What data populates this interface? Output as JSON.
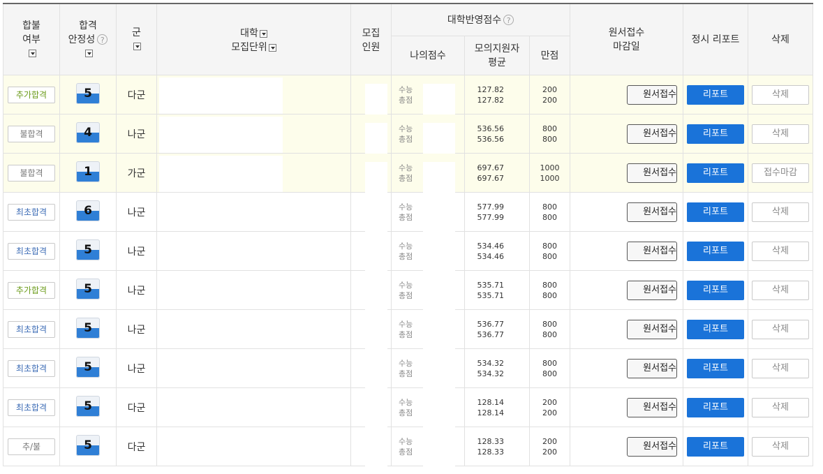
{
  "header": {
    "result": [
      "합불",
      "여부"
    ],
    "stability": [
      "합격",
      "안정성"
    ],
    "group": "군",
    "univ": "대학",
    "unit": "모집단위",
    "recruit": [
      "모집",
      "인원"
    ],
    "score_group": "대학반영점수",
    "my_score": "나의점수",
    "mock_avg": [
      "모의지원자",
      "평균"
    ],
    "full_score": "만점",
    "deadline": [
      "원서접수",
      "마감일"
    ],
    "report": "정시 리포트",
    "delete": "삭제",
    "help_glyph": "?"
  },
  "rows": [
    {
      "status": "추가합격",
      "status_type": "add",
      "stability": "5",
      "group": "다군",
      "score_label1": "수능",
      "score_label2": "총점",
      "avg1": "127.82",
      "avg2": "127.82",
      "full1": "200",
      "full2": "200",
      "apply": "원서접수",
      "report": "리포트",
      "action": "삭제",
      "highlight": true
    },
    {
      "status": "불합격",
      "status_type": "fail",
      "stability": "4",
      "group": "나군",
      "score_label1": "수능",
      "score_label2": "총점",
      "avg1": "536.56",
      "avg2": "536.56",
      "full1": "800",
      "full2": "800",
      "apply": "원서접수",
      "report": "리포트",
      "action": "삭제",
      "highlight": true
    },
    {
      "status": "불합격",
      "status_type": "fail",
      "stability": "1",
      "group": "가군",
      "score_label1": "수능",
      "score_label2": "총점",
      "avg1": "697.67",
      "avg2": "697.67",
      "full1": "1000",
      "full2": "1000",
      "apply": "원서접수",
      "report": "리포트",
      "action": "접수마감",
      "highlight": true
    },
    {
      "status": "최초합격",
      "status_type": "pass",
      "stability": "6",
      "group": "나군",
      "score_label1": "수능",
      "score_label2": "총점",
      "avg1": "577.99",
      "avg2": "577.99",
      "full1": "800",
      "full2": "800",
      "apply": "원서접수",
      "report": "리포트",
      "action": "삭제",
      "highlight": false
    },
    {
      "status": "최초합격",
      "status_type": "pass",
      "stability": "5",
      "group": "나군",
      "score_label1": "수능",
      "score_label2": "총점",
      "avg1": "534.46",
      "avg2": "534.46",
      "full1": "800",
      "full2": "800",
      "apply": "원서접수",
      "report": "리포트",
      "action": "삭제",
      "highlight": false
    },
    {
      "status": "추가합격",
      "status_type": "add",
      "stability": "5",
      "group": "나군",
      "score_label1": "수능",
      "score_label2": "총점",
      "avg1": "535.71",
      "avg2": "535.71",
      "full1": "800",
      "full2": "800",
      "apply": "원서접수",
      "report": "리포트",
      "action": "삭제",
      "highlight": false
    },
    {
      "status": "최초합격",
      "status_type": "pass",
      "stability": "5",
      "group": "나군",
      "score_label1": "수능",
      "score_label2": "총점",
      "avg1": "536.77",
      "avg2": "536.77",
      "full1": "800",
      "full2": "800",
      "apply": "원서접수",
      "report": "리포트",
      "action": "삭제",
      "highlight": false
    },
    {
      "status": "최초합격",
      "status_type": "pass",
      "stability": "5",
      "group": "나군",
      "score_label1": "수능",
      "score_label2": "총점",
      "avg1": "534.32",
      "avg2": "534.32",
      "full1": "800",
      "full2": "800",
      "apply": "원서접수",
      "report": "리포트",
      "action": "삭제",
      "highlight": false
    },
    {
      "status": "최초합격",
      "status_type": "pass",
      "stability": "5",
      "group": "다군",
      "score_label1": "수능",
      "score_label2": "총점",
      "avg1": "128.14",
      "avg2": "128.14",
      "full1": "200",
      "full2": "200",
      "apply": "원서접수",
      "report": "리포트",
      "action": "삭제",
      "highlight": false
    },
    {
      "status": "추/불",
      "status_type": "fail",
      "stability": "5",
      "group": "다군",
      "score_label1": "수능",
      "score_label2": "총점",
      "avg1": "128.33",
      "avg2": "128.33",
      "full1": "200",
      "full2": "200",
      "apply": "원서접수",
      "report": "리포트",
      "action": "삭제",
      "highlight": false
    }
  ],
  "colors": {
    "report_button": "#1a73d9",
    "highlight_row": "#fdfdeb",
    "pass": "#3b6bb5",
    "add": "#6b9b1a",
    "fail": "#777777"
  }
}
